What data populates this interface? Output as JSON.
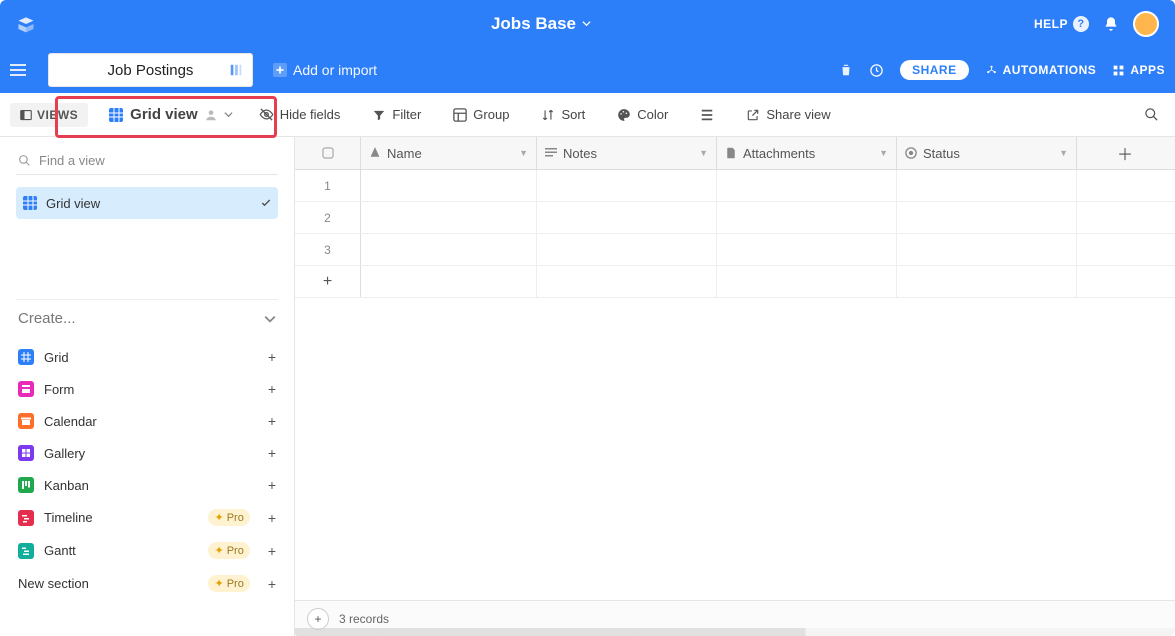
{
  "header": {
    "base_title": "Jobs Base",
    "help_label": "HELP",
    "share_label": "SHARE",
    "automations_label": "AUTOMATIONS",
    "apps_label": "APPS"
  },
  "tabs": {
    "editing_value": "Job Postings",
    "add_or_import": "Add or import"
  },
  "toolbar": {
    "views_label": "VIEWS",
    "current_view_label": "Grid view",
    "hide_fields": "Hide fields",
    "filter": "Filter",
    "group": "Group",
    "sort": "Sort",
    "color": "Color",
    "share_view": "Share view"
  },
  "sidebar": {
    "find_placeholder": "Find a view",
    "views": [
      {
        "label": "Grid view",
        "active": true
      }
    ],
    "create_header": "Create...",
    "create_options": [
      {
        "label": "Grid",
        "icon": "grid",
        "color": "#2d7ff9",
        "pro": false
      },
      {
        "label": "Form",
        "icon": "form",
        "color": "#e929ba",
        "pro": false
      },
      {
        "label": "Calendar",
        "icon": "calendar",
        "color": "#ff6f2c",
        "pro": false
      },
      {
        "label": "Gallery",
        "icon": "gallery",
        "color": "#7c39ed",
        "pro": false
      },
      {
        "label": "Kanban",
        "icon": "kanban",
        "color": "#20a84c",
        "pro": false
      },
      {
        "label": "Timeline",
        "icon": "timeline",
        "color": "#e52e4d",
        "pro": true
      },
      {
        "label": "Gantt",
        "icon": "gantt",
        "color": "#11af9b",
        "pro": true
      },
      {
        "label": "New section",
        "icon": "section",
        "color": "#777",
        "pro": true
      }
    ],
    "pro_badge_label": "Pro"
  },
  "grid": {
    "columns": [
      {
        "label": "Name",
        "type": "text"
      },
      {
        "label": "Notes",
        "type": "long_text"
      },
      {
        "label": "Attachments",
        "type": "attachment"
      },
      {
        "label": "Status",
        "type": "single_select"
      }
    ],
    "rows": [
      {
        "id": "1"
      },
      {
        "id": "2"
      },
      {
        "id": "3"
      }
    ],
    "footer_summary": "3 records"
  }
}
